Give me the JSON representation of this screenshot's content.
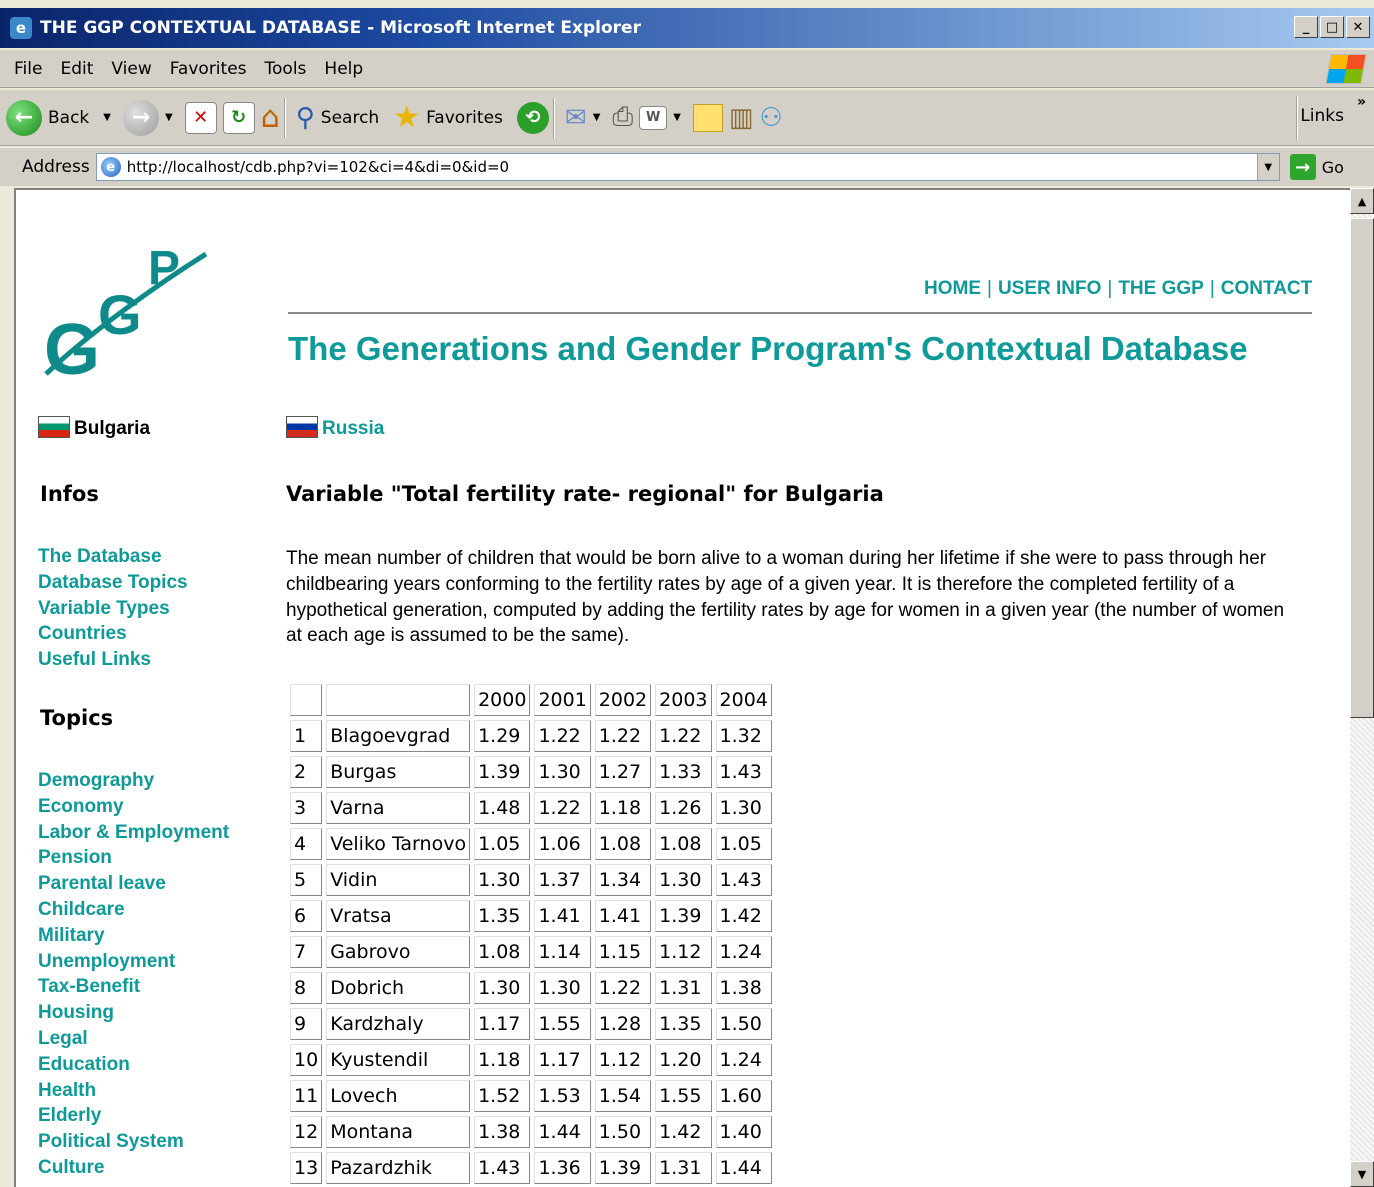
{
  "window": {
    "title": "THE GGP CONTEXTUAL DATABASE - Microsoft Internet Explorer",
    "min": "_",
    "max": "□",
    "close": "✕"
  },
  "menu": [
    "File",
    "Edit",
    "View",
    "Favorites",
    "Tools",
    "Help"
  ],
  "toolbar": {
    "back_label": "Back",
    "search_label": "Search",
    "favorites_label": "Favorites",
    "links_label": "Links"
  },
  "address": {
    "label": "Address",
    "url": "http://localhost/cdb.php?vi=102&ci=4&di=0&id=0",
    "go_label": "Go"
  },
  "page": {
    "topnav": [
      "HOME",
      "USER INFO",
      "THE GGP",
      "CONTACT"
    ],
    "heading": "The Generations and Gender Program's Contextual Database",
    "current_country": "Bulgaria",
    "other_country": "Russia",
    "infos_heading": "Infos",
    "infos_links": [
      "The Database",
      "Database Topics",
      "Variable Types",
      "Countries",
      "Useful Links"
    ],
    "topics_heading": "Topics",
    "topics_links": [
      "Demography",
      "Economy",
      "Labor & Employment",
      "Pension",
      "Parental leave",
      "Childcare",
      "Military",
      "Unemployment",
      "Tax-Benefit",
      "Housing",
      "Legal",
      "Education",
      "Health",
      "Elderly",
      "Political System",
      "Culture"
    ],
    "variable_title": "Variable \"Total fertility rate- regional\" for Bulgaria",
    "description": "The mean number of children that would be born alive to a woman during her lifetime if she were to pass through her childbearing years conforming to the fertility rates by age of a given year. It is therefore the completed fertility of a hypothetical generation, computed by adding the fertility rates by age for women in a given year (the number of women at each age is assumed to be the same)."
  },
  "table": {
    "years": [
      "2000",
      "2001",
      "2002",
      "2003",
      "2004"
    ],
    "rows": [
      [
        "1",
        "Blagoevgrad",
        "1.29",
        "1.22",
        "1.22",
        "1.22",
        "1.32"
      ],
      [
        "2",
        "Burgas",
        "1.39",
        "1.30",
        "1.27",
        "1.33",
        "1.43"
      ],
      [
        "3",
        "Varna",
        "1.48",
        "1.22",
        "1.18",
        "1.26",
        "1.30"
      ],
      [
        "4",
        "Veliko Tarnovo",
        "1.05",
        "1.06",
        "1.08",
        "1.08",
        "1.05"
      ],
      [
        "5",
        "Vidin",
        "1.30",
        "1.37",
        "1.34",
        "1.30",
        "1.43"
      ],
      [
        "6",
        "Vratsa",
        "1.35",
        "1.41",
        "1.41",
        "1.39",
        "1.42"
      ],
      [
        "7",
        "Gabrovo",
        "1.08",
        "1.14",
        "1.15",
        "1.12",
        "1.24"
      ],
      [
        "8",
        "Dobrich",
        "1.30",
        "1.30",
        "1.22",
        "1.31",
        "1.38"
      ],
      [
        "9",
        "Kardzhaly",
        "1.17",
        "1.55",
        "1.28",
        "1.35",
        "1.50"
      ],
      [
        "10",
        "Kyustendil",
        "1.18",
        "1.17",
        "1.12",
        "1.20",
        "1.24"
      ],
      [
        "11",
        "Lovech",
        "1.52",
        "1.53",
        "1.54",
        "1.55",
        "1.60"
      ],
      [
        "12",
        "Montana",
        "1.38",
        "1.44",
        "1.50",
        "1.42",
        "1.40"
      ],
      [
        "13",
        "Pazardzhik",
        "1.43",
        "1.36",
        "1.39",
        "1.31",
        "1.44"
      ]
    ]
  },
  "colors": {
    "link": "#0f9a9a",
    "titlebar": "#0a246a",
    "chrome": "#d4d0c8"
  }
}
